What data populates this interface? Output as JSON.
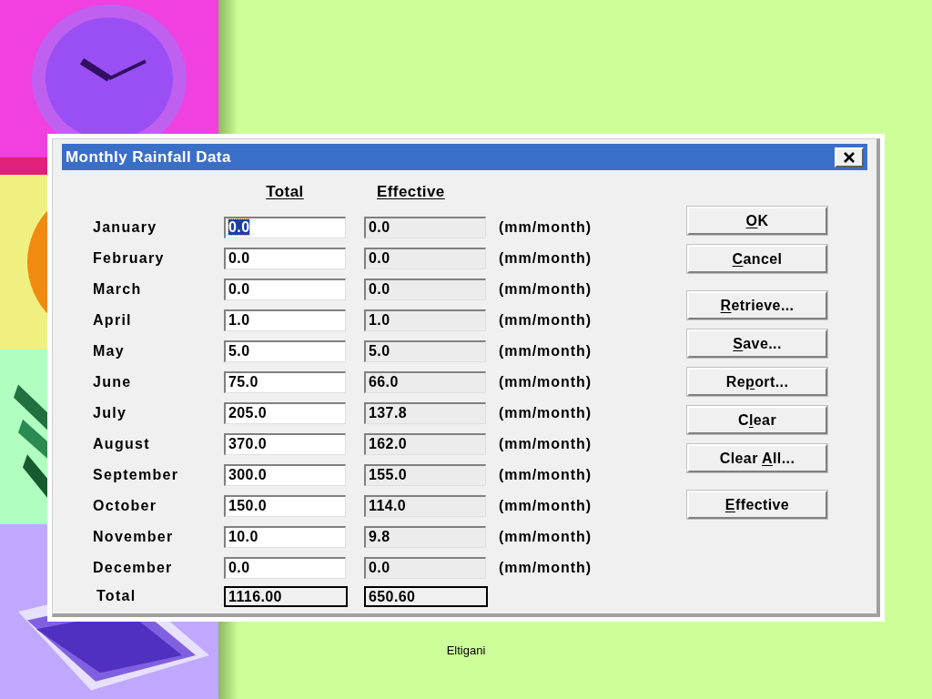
{
  "dialog": {
    "title": "Monthly Rainfall Data",
    "headers": {
      "total": "Total",
      "effective": "Effective"
    },
    "rows": [
      {
        "month": "January",
        "total": "0.0",
        "effective": "0.0",
        "unit": "(mm/month)",
        "text_selected": true
      },
      {
        "month": "February",
        "total": "0.0",
        "effective": "0.0",
        "unit": "(mm/month)",
        "text_selected": false
      },
      {
        "month": "March",
        "total": "0.0",
        "effective": "0.0",
        "unit": "(mm/month)",
        "text_selected": false
      },
      {
        "month": "April",
        "total": "1.0",
        "effective": "1.0",
        "unit": "(mm/month)",
        "text_selected": false
      },
      {
        "month": "May",
        "total": "5.0",
        "effective": "5.0",
        "unit": "(mm/month)",
        "text_selected": false
      },
      {
        "month": "June",
        "total": "75.0",
        "effective": "66.0",
        "unit": "(mm/month)",
        "text_selected": false
      },
      {
        "month": "July",
        "total": "205.0",
        "effective": "137.8",
        "unit": "(mm/month)",
        "text_selected": false
      },
      {
        "month": "August",
        "total": "370.0",
        "effective": "162.0",
        "unit": "(mm/month)",
        "text_selected": false
      },
      {
        "month": "September",
        "total": "300.0",
        "effective": "155.0",
        "unit": "(mm/month)",
        "text_selected": false
      },
      {
        "month": "October",
        "total": "150.0",
        "effective": "114.0",
        "unit": "(mm/month)",
        "text_selected": false
      },
      {
        "month": "November",
        "total": "10.0",
        "effective": "9.8",
        "unit": "(mm/month)",
        "text_selected": false
      },
      {
        "month": "December",
        "total": "0.0",
        "effective": "0.0",
        "unit": "(mm/month)",
        "text_selected": false
      }
    ],
    "totals": {
      "label": "Total",
      "total": "1116.00",
      "effective": "650.60"
    },
    "button_groups": [
      [
        {
          "key": "O",
          "after": "K"
        },
        {
          "key": "C",
          "after": "ancel"
        }
      ],
      [
        {
          "key": "R",
          "after": "etrieve..."
        },
        {
          "key": "S",
          "after": "ave..."
        },
        {
          "before": "Re",
          "key": "p",
          "after": "ort..."
        },
        {
          "before": "C",
          "key": "l",
          "after": "ear"
        },
        {
          "before": "Clear ",
          "key": "A",
          "after": "ll..."
        }
      ],
      [
        {
          "key": "E",
          "after": "ffective"
        }
      ]
    ]
  },
  "footer": "Eltigani"
}
